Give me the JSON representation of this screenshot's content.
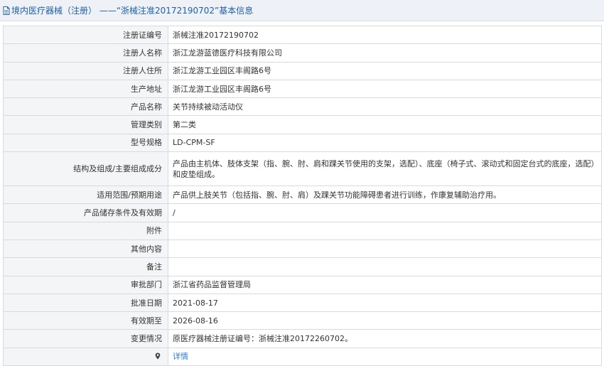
{
  "header": {
    "title": "境内医疗器械（注册） ——“浙械注准20172190702”基本信息"
  },
  "rows": [
    {
      "label": "注册证编号",
      "value": "浙械注准20172190702"
    },
    {
      "label": "注册人名称",
      "value": "浙江龙游蓝德医疗科技有限公司"
    },
    {
      "label": "注册人住所",
      "value": "浙江龙游工业园区丰阁路6号"
    },
    {
      "label": "生产地址",
      "value": "浙江龙游工业园区丰阁路6号"
    },
    {
      "label": "产品名称",
      "value": "关节持续被动活动仪"
    },
    {
      "label": "管理类别",
      "value": "第二类"
    },
    {
      "label": "型号规格",
      "value": "LD-CPM-SF"
    },
    {
      "label": "结构及组成/主要组成成分",
      "value": "产品由主机体、肢体支架（指、腕、肘、肩和踝关节使用的支架，选配）、底座（椅子式、滚动式和固定台式的底座，选配）和皮垫组成。"
    },
    {
      "label": "适用范围/预期用途",
      "value": "产品供上肢关节（包括指、腕、肘、肩）及踝关节功能障碍患者进行训练，作康复辅助治疗用。"
    },
    {
      "label": "产品储存条件及有效期",
      "value": "/"
    },
    {
      "label": "附件",
      "value": ""
    },
    {
      "label": "其他内容",
      "value": ""
    },
    {
      "label": "备注",
      "value": ""
    },
    {
      "label": "审批部门",
      "value": "浙江省药品监督管理局"
    },
    {
      "label": "批准日期",
      "value": "2021-08-17"
    },
    {
      "label": "有效期至",
      "value": "2026-08-16"
    },
    {
      "label": "变更情况",
      "value": "原医疗器械注册证编号：浙械注准20172260702。"
    }
  ],
  "details_row": {
    "icon": "map-pin-icon",
    "link_label": "详情",
    "link_color": "#2f7ad6"
  }
}
